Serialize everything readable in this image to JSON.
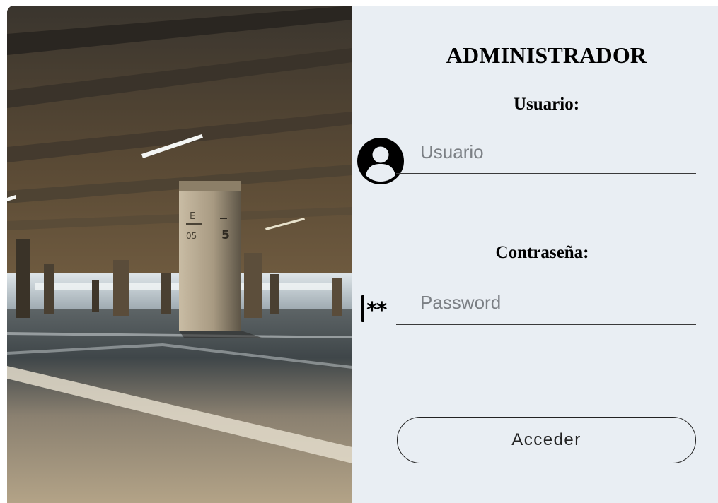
{
  "login": {
    "title": "ADMINISTRADOR",
    "username": {
      "label": "Usuario:",
      "placeholder": "Usuario",
      "value": "",
      "icon": "user-avatar-icon"
    },
    "password": {
      "label": "Contraseña:",
      "placeholder": "Password",
      "value": "",
      "icon": "password-asterisk-icon",
      "icon_glyph": "**"
    },
    "submit_label": "Acceder"
  },
  "colors": {
    "form_background": "#e9eef3",
    "text": "#000000",
    "placeholder": "#7b7f84",
    "input_underline": "#3a3a3a",
    "button_border": "#222222"
  }
}
